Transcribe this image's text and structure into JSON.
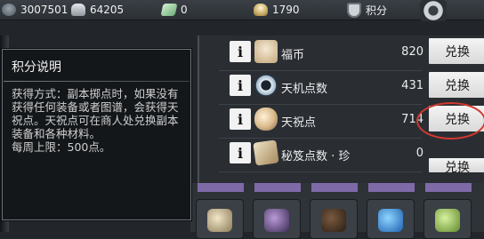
{
  "topbar": {
    "player_id": "3007501",
    "silver": "64205",
    "jade": "0",
    "coins": "1790",
    "points_label": "积分"
  },
  "tooltip": {
    "title": "积分说明",
    "body": "获得方式：副本掷点时，如果没有获得任何装备或者图谱，会获得天祝点。天祝点可在商人处兑换副本装备和各种材料。\n每周上限：500点。"
  },
  "shop": {
    "info_label": "i",
    "exchange_label": "兑换",
    "items": [
      {
        "name": "福币",
        "count": "820",
        "icon": "fubi-icon"
      },
      {
        "name": "天机点数",
        "count": "431",
        "icon": "tianji-icon"
      },
      {
        "name": "天祝点",
        "count": "714",
        "icon": "tianzhu-icon"
      },
      {
        "name": "秘笈点数 · 珍",
        "count": "0",
        "icon": "scroll-icon"
      }
    ]
  },
  "highlight_color": "#d0382f"
}
